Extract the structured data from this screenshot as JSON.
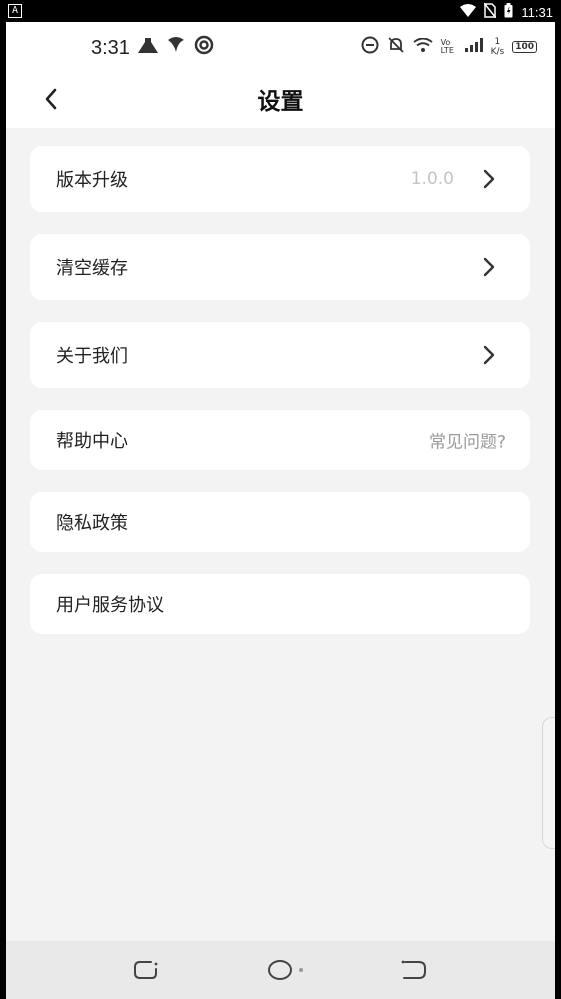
{
  "system_bar": {
    "badge": "A",
    "time": "11:31"
  },
  "inner_status": {
    "time": "3:31",
    "net_speed_top": "1",
    "net_speed_bottom": "K/s",
    "volte": "Vo LTE",
    "battery": "100"
  },
  "header": {
    "title": "设置"
  },
  "settings": [
    {
      "label": "版本升级",
      "value": "1.0.0",
      "chevron": true
    },
    {
      "label": "清空缓存",
      "value": "",
      "chevron": true
    },
    {
      "label": "关于我们",
      "value": "",
      "chevron": true
    },
    {
      "label": "帮助中心",
      "value": "常见问题?",
      "chevron": false
    },
    {
      "label": "隐私政策",
      "value": "",
      "chevron": false
    },
    {
      "label": "用户服务协议",
      "value": "",
      "chevron": false
    }
  ],
  "colors": {
    "background": "#f3f3f3",
    "card": "#ffffff",
    "text": "#222222",
    "muted": "#9a9a9a"
  }
}
